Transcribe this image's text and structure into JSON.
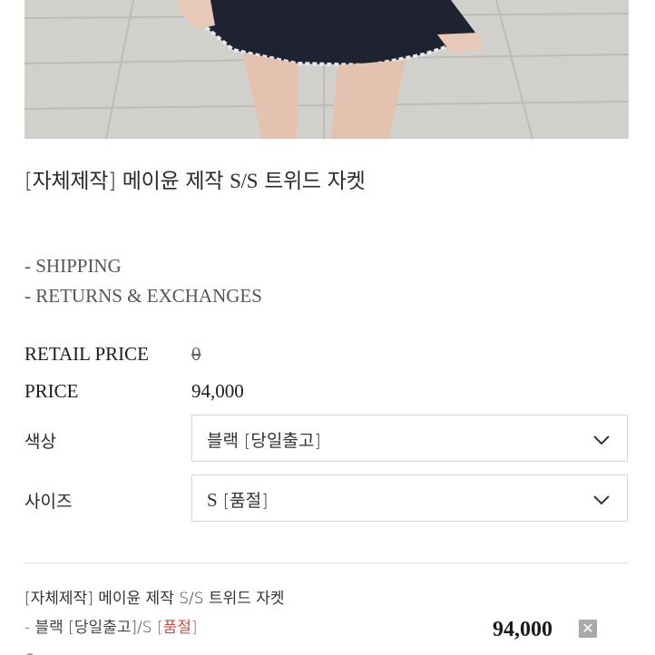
{
  "product": {
    "title_prefix": "[자체제작] 메이윤 제작 ",
    "title_latin": "S/S",
    "title_suffix": " 트위드 자켓"
  },
  "links": [
    "- SHIPPING",
    "- RETURNS & EXCHANGES"
  ],
  "retail_price": {
    "label": "RETAIL PRICE",
    "value": "0"
  },
  "price": {
    "label": "PRICE",
    "value": "94,000"
  },
  "color_option": {
    "label": "색상",
    "selected": "블랙 [당일출고]"
  },
  "size_option": {
    "label": "사이즈",
    "selected_latin": "S",
    "selected_rest": " [품절]"
  },
  "cart": {
    "name": "[자체제작] 메이윤 제작 S/S 트위드 자켓",
    "option_prefix": "- 블랙 [당일출고]/S ",
    "option_status": "[품절]",
    "price": "94,000",
    "remove_symbol": "✕"
  },
  "colors": {
    "soldout": "#c0504d",
    "border": "#d6d6d6",
    "pavement": "#c9c7c3",
    "skirt": "#1f2230"
  }
}
